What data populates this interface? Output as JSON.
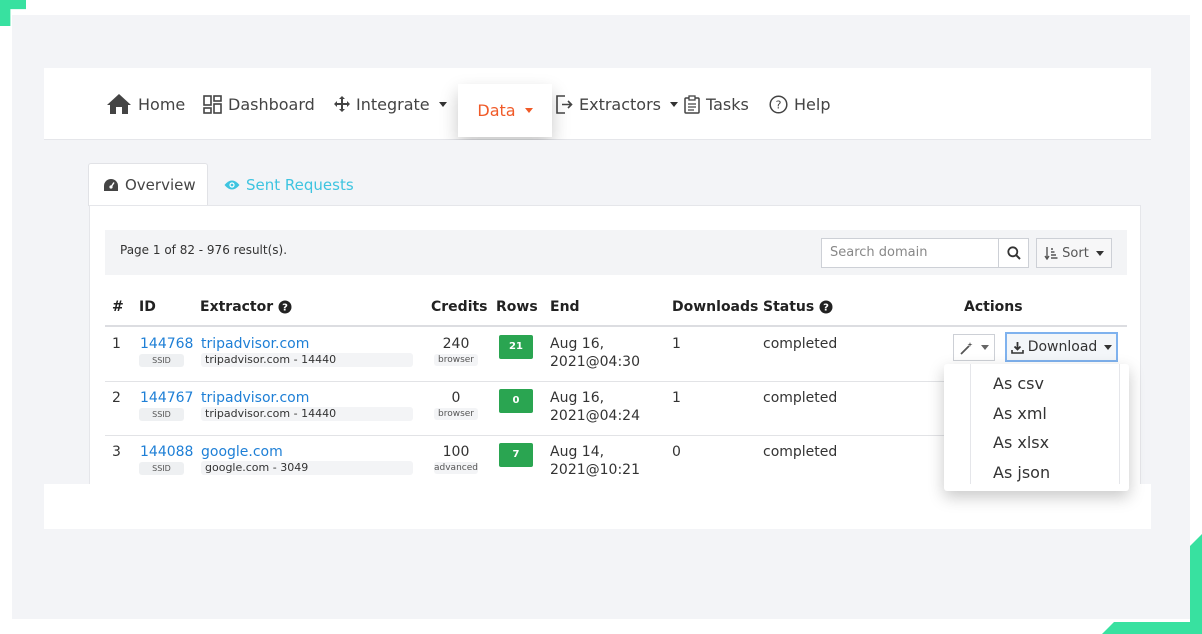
{
  "nav": {
    "home": "Home",
    "dashboard": "Dashboard",
    "integrate": "Integrate",
    "data": "Data",
    "extractors": "Extractors",
    "tasks": "Tasks",
    "help": "Help"
  },
  "tabs": {
    "overview": "Overview",
    "sent_requests": "Sent Requests"
  },
  "summary": {
    "count_text": "Page 1 of 82 - 976 result(s).",
    "search_placeholder": "Search domain",
    "sort_label": "Sort"
  },
  "table": {
    "headers": {
      "num": "#",
      "id": "ID",
      "extractor": "Extractor",
      "credits": "Credits",
      "rows": "Rows",
      "end": "End",
      "downloads": "Downloads",
      "status": "Status",
      "actions": "Actions"
    },
    "rows": [
      {
        "num": "1",
        "id": "144768",
        "ssid": "SSID",
        "extractor": "tripadvisor.com",
        "extractor_sub": "tripadvisor.com - 14440",
        "credits": "240",
        "credits_sub": "browser",
        "rows": "21",
        "end_line1": "Aug 16,",
        "end_line2": "2021@04:30",
        "downloads": "1",
        "status": "completed"
      },
      {
        "num": "2",
        "id": "144767",
        "ssid": "SSID",
        "extractor": "tripadvisor.com",
        "extractor_sub": "tripadvisor.com - 14440",
        "credits": "0",
        "credits_sub": "browser",
        "rows": "0",
        "end_line1": "Aug 16,",
        "end_line2": "2021@04:24",
        "downloads": "1",
        "status": "completed"
      },
      {
        "num": "3",
        "id": "144088",
        "ssid": "SSID",
        "extractor": "google.com",
        "extractor_sub": "google.com - 3049",
        "credits": "100",
        "credits_sub": "advanced",
        "rows": "7",
        "end_line1": "Aug 14,",
        "end_line2": "2021@10:21",
        "downloads": "0",
        "status": "completed"
      }
    ]
  },
  "download": {
    "label": "Download",
    "options": [
      "As csv",
      "As xml",
      "As xlsx",
      "As json"
    ]
  },
  "colors": {
    "accent_orange": "#f05a28",
    "link_blue": "#1e7fd6",
    "tab_cyan": "#3ec4e0",
    "badge_green": "#2aa551",
    "corner_green": "#38e1a0"
  }
}
